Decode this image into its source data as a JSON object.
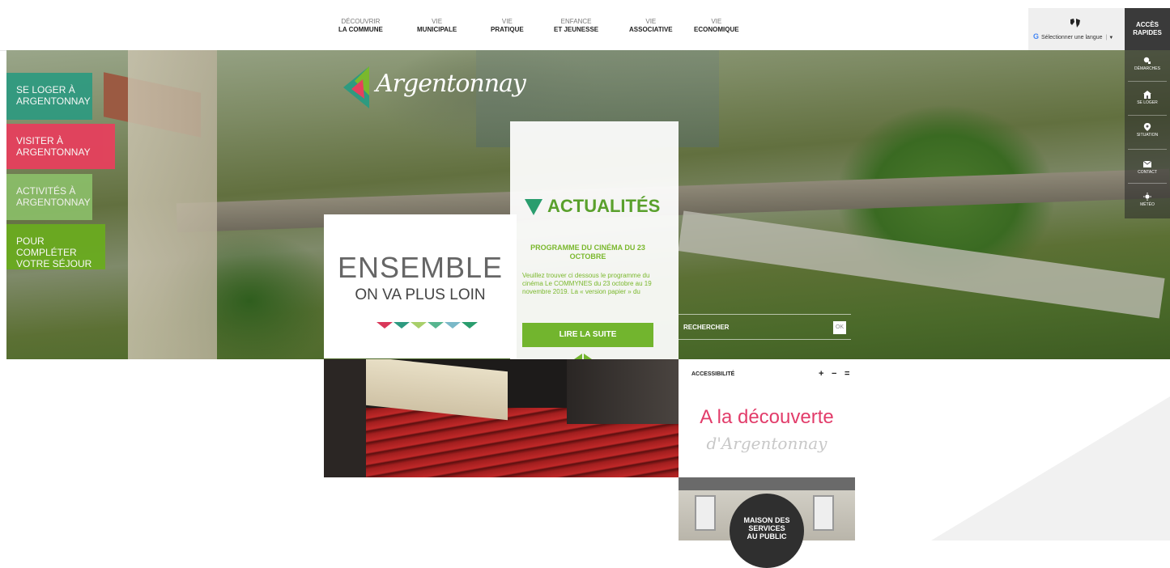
{
  "nav": {
    "items": [
      {
        "line1": "DÉCOUVRIR",
        "line2": "LA COMMUNE"
      },
      {
        "line1": "VIE",
        "line2": "MUNICIPALE"
      },
      {
        "line1": "VIE",
        "line2": "PRATIQUE"
      },
      {
        "line1": "ENFANCE",
        "line2": "ET JEUNESSE"
      },
      {
        "line1": "VIE",
        "line2": "ASSOCIATIVE"
      },
      {
        "line1": "VIE",
        "line2": "ECONOMIQUE"
      }
    ]
  },
  "language": {
    "select_label": "Sélectionner une langue",
    "google_mark": "G",
    "separator": "|",
    "arrow": "▼"
  },
  "quick_access": {
    "title_line1": "ACCÈS",
    "title_line2": "RAPIDES",
    "items": [
      {
        "label": "DÉMARCHES",
        "icon": "users-search-icon"
      },
      {
        "label": "SE LOGER",
        "icon": "house-icon"
      },
      {
        "label": "SITUATION",
        "icon": "map-pin-icon"
      },
      {
        "label": "CONTACT",
        "icon": "envelope-icon"
      },
      {
        "label": "MÉTÉO",
        "icon": "sun-icon"
      }
    ]
  },
  "logo": {
    "text": "Argentonnay"
  },
  "side_links": [
    {
      "line1": "SE LOGER À",
      "line2": "ARGENTONNAY",
      "color": "#2e9a80"
    },
    {
      "line1": "VISITER À",
      "line2": "ARGENTONNAY",
      "color": "#e6405d"
    },
    {
      "line1": "ACTIVITÉS À",
      "line2": "ARGENTONNAY",
      "color": "#8cc06a"
    },
    {
      "line1": "POUR COMPLÉTER",
      "line2": "VOTRE SÉJOUR",
      "color": "#6aab1f"
    }
  ],
  "hero": {
    "title": "ENSEMBLE",
    "subtitle": "ON VA PLUS LOIN",
    "triangle_colors": [
      "#d9385a",
      "#2e9a80",
      "#a8cf6a",
      "#57b58f",
      "#7ab8c8",
      "#2a9d6e"
    ]
  },
  "news": {
    "title": "ACTUALITÉS",
    "headline": "PROGRAMME DU CINÉMA DU 23 OCTOBRE",
    "body": "Veuillez trouver ci dessous le programme du cinéma Le COMMYNES du 23 octobre au 19 novembre 2019. La « version papier » du",
    "read_more": "LIRE LA SUITE"
  },
  "search": {
    "label": "RECHERCHER",
    "ok": "OK"
  },
  "accessibility": {
    "label": "ACCESSIBILITÉ",
    "increase": "+",
    "decrease": "−",
    "reset": "="
  },
  "discover": {
    "title": "A la découverte",
    "subtitle": "d'Argentonnay"
  },
  "maison": {
    "line1": "MAISON DES",
    "line2": "SERVICES",
    "line3": "AU PUBLIC"
  },
  "colors": {
    "accent_green": "#72b52e",
    "accent_pink": "#e23c6a",
    "dark": "#3a3a3a"
  }
}
